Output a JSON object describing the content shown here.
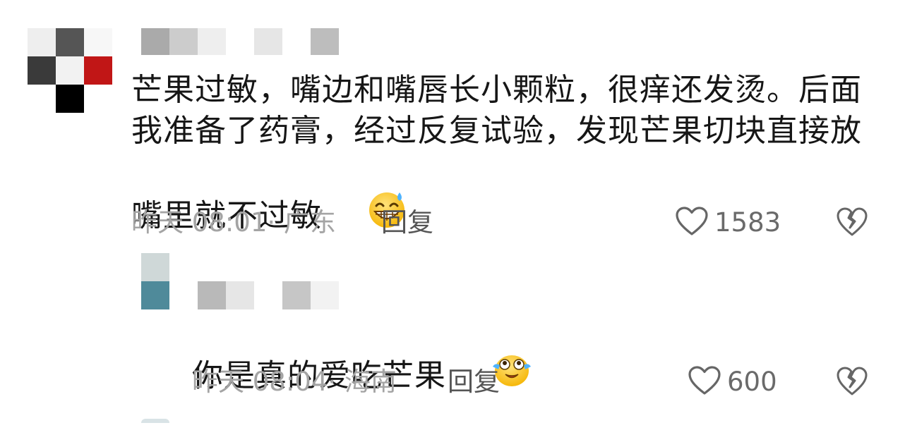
{
  "colors": {
    "text": "#161616",
    "meta": "#a4a4a4",
    "reply": "#555555",
    "like_count": "#6a6a6a",
    "icon_stroke": "#666666"
  },
  "comments": [
    {
      "avatar_pixels": [
        "#eeeeee",
        "#555555",
        "#f7f7f7",
        "#3a3a3a",
        "#f2f2f2",
        "#c11616",
        "#ffffff",
        "#000000",
        "#ffffff"
      ],
      "username_mosaic": [
        "#aaaaaa",
        "#cccccc",
        "#eeeeee",
        "#ffffff",
        "#e6e6e6",
        "#ffffff",
        "#bdbdbd"
      ],
      "text": "芒果过敏，嘴边和嘴唇长小颗粒，很痒还发烫。后面我准备了药膏，经过反复试验，发现芒果切块直接放嘴里就不过敏",
      "emoji": "grinning-sweat-emoji",
      "time_location": "昨天 08:01· 广东",
      "reply_label": "回复",
      "likes": "1583",
      "like_icon": "heart-outline-icon",
      "dislike_icon": "broken-heart-icon"
    },
    {
      "avatar_pixels": [
        "#cfd8d8",
        "#4f8a9a"
      ],
      "username_mosaic": [
        "#b9b9b9",
        "#e6e6e6",
        "#ffffff",
        "#c6c6c6",
        "#f2f2f2"
      ],
      "text": "你是真的爱吃芒果",
      "emoji": "crying-laughing-emoji",
      "time_location": "昨天 08:04· 海南",
      "reply_label": "回复",
      "likes": "600",
      "like_icon": "heart-outline-icon",
      "dislike_icon": "broken-heart-icon"
    }
  ]
}
